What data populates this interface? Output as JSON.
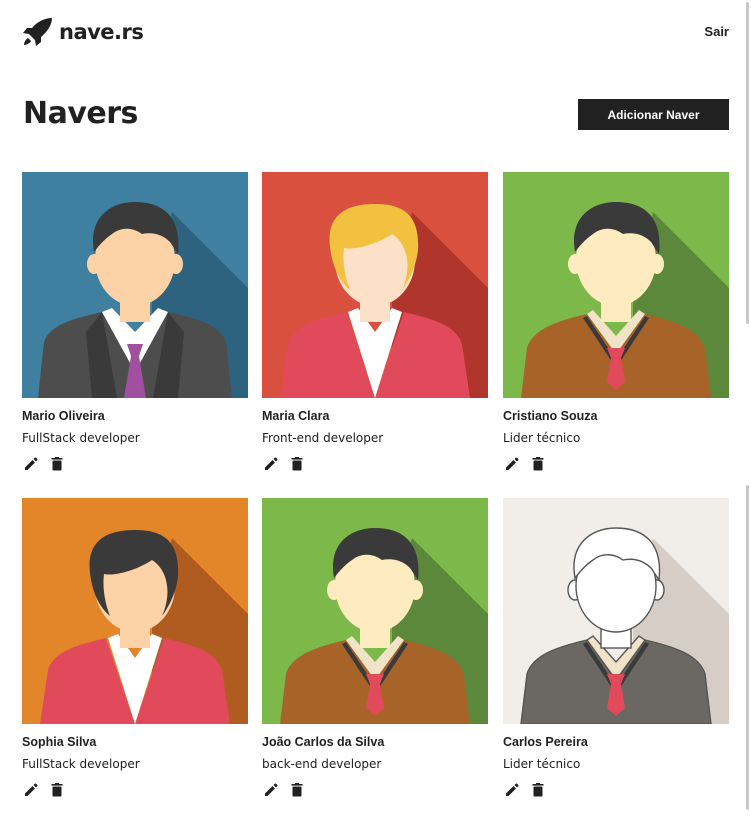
{
  "header": {
    "logo_text": "nave.rs",
    "logo_icon": "rocket-icon",
    "logout_label": "Sair"
  },
  "page": {
    "title": "Navers",
    "add_button_label": "Adicionar Naver"
  },
  "navers": [
    {
      "name": "Mario Oliveira",
      "role": "FullStack developer",
      "bg": "#3f7fa0",
      "shadow": "#2a5e78",
      "hair": "#3a3a3a",
      "skin": "#fcd2a6",
      "outfit": "suit",
      "outfit_color": "#4d4d4d",
      "tie": "#a0509e",
      "gender": "male"
    },
    {
      "name": "Maria Clara",
      "role": "Front-end developer",
      "bg": "#d9503f",
      "shadow": "#a8302a",
      "hair": "#f2c13f",
      "skin": "#fde0c8",
      "outfit": "blazer",
      "outfit_color": "#e04a5b",
      "tie": "",
      "gender": "female"
    },
    {
      "name": "Cristiano Souza",
      "role": "Lider técnico",
      "bg": "#7db84a",
      "shadow": "#557f37",
      "hair": "#3a3a3a",
      "skin": "#feebc0",
      "outfit": "sweater",
      "outfit_color": "#a86428",
      "tie": "#e04a5b",
      "gender": "male"
    },
    {
      "name": "Sophia Silva",
      "role": "FullStack developer",
      "bg": "#e38529",
      "shadow": "#a7531e",
      "hair": "#3a3a3a",
      "skin": "#fcd2a6",
      "outfit": "blazer",
      "outfit_color": "#e04a5b",
      "tie": "",
      "gender": "female"
    },
    {
      "name": "João Carlos da Silva",
      "role": "back-end developer",
      "bg": "#7db84a",
      "shadow": "#557f37",
      "hair": "#3a3a3a",
      "skin": "#feebc0",
      "outfit": "sweater",
      "outfit_color": "#a86428",
      "tie": "#e04a5b",
      "gender": "male"
    },
    {
      "name": "Carlos Pereira",
      "role": "Lider técnico",
      "bg": "#f1eeea",
      "shadow": "#d1c8bf",
      "hair": "#ffffff",
      "skin": "#ffffff",
      "outfit": "sweater",
      "outfit_color": "#6b6863",
      "tie": "#e04a5b",
      "gender": "outline"
    }
  ],
  "icons": {
    "edit": "pencil-icon",
    "delete": "trash-icon"
  }
}
